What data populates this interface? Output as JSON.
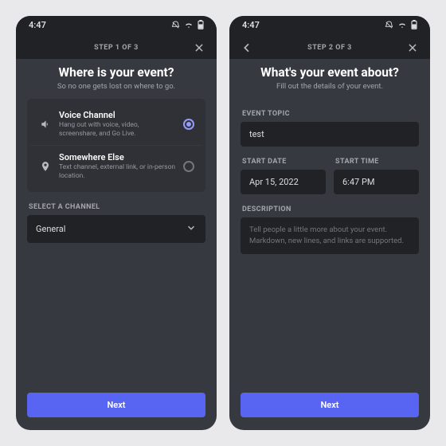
{
  "status": {
    "time": "4:47"
  },
  "screen1": {
    "step": "STEP 1 OF 3",
    "title": "Where is your event?",
    "subtitle": "So no one gets lost on where to go.",
    "options": [
      {
        "title": "Voice Channel",
        "subtitle": "Hang out with voice, video, screenshare, and Go Live.",
        "selected": true
      },
      {
        "title": "Somewhere Else",
        "subtitle": "Text channel, external link, or in-person location.",
        "selected": false
      }
    ],
    "channel_label": "SELECT A CHANNEL",
    "channel_value": "General",
    "next": "Next"
  },
  "screen2": {
    "step": "STEP 2 OF 3",
    "title": "What's your event about?",
    "subtitle": "Fill out the details of your event.",
    "topic_label": "EVENT TOPIC",
    "topic_value": "test",
    "date_label": "START DATE",
    "date_value": "Apr 15, 2022",
    "time_label": "START TIME",
    "time_value": "6:47 PM",
    "desc_label": "DESCRIPTION",
    "desc_placeholder": "Tell people a little more about your event. Markdown, new lines, and links are supported.",
    "next": "Next"
  }
}
